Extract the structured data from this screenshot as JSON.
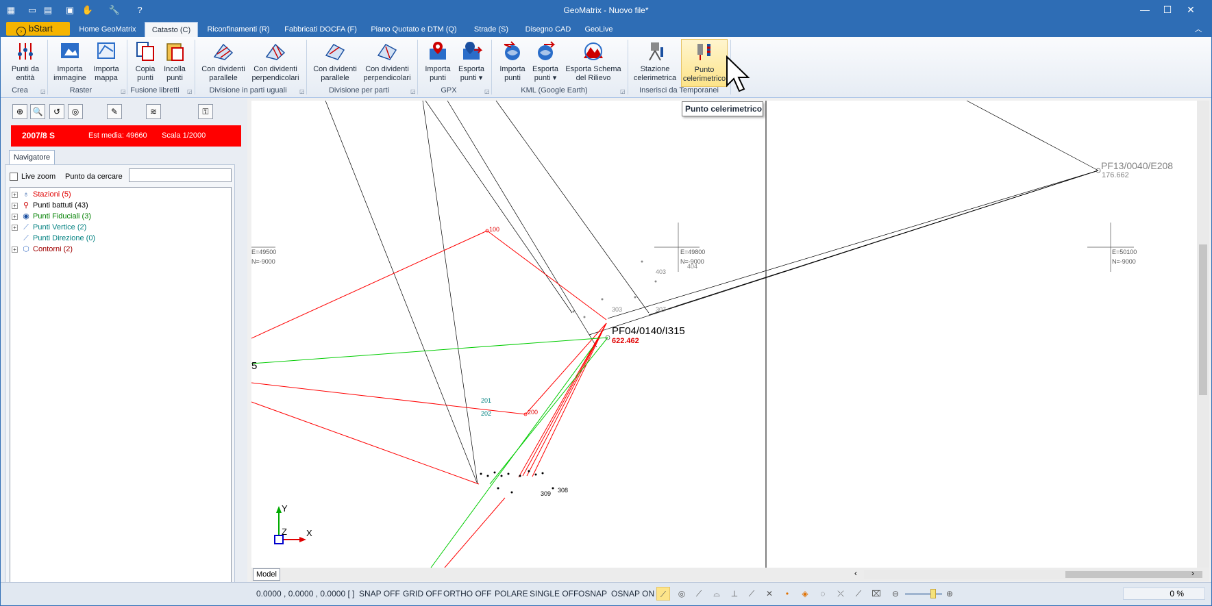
{
  "window": {
    "title": "GeoMatrix - Nuovo file*"
  },
  "quick_access": [
    "app-menu-icon",
    "new-file-icon",
    "open-file-icon",
    "save-icon",
    "hand-icon",
    "wrench-icon",
    "help-icon"
  ],
  "tabs": {
    "bstart": "bStart",
    "items": [
      {
        "label": "Home GeoMatrix"
      },
      {
        "label": "Catasto (C)"
      },
      {
        "label": "Riconfinamenti (R)"
      },
      {
        "label": "Fabbricati DOCFA (F)"
      },
      {
        "label": "Piano Quotato e DTM (Q)"
      },
      {
        "label": "Strade (S)"
      },
      {
        "label": "Disegno CAD"
      },
      {
        "label": "GeoLive"
      }
    ]
  },
  "ribbon": {
    "buttons": {
      "punti_entita": "Punti da\nentità",
      "importa_immagine": "Importa\nimmagine",
      "importa_mappa": "Importa\nmappa",
      "copia_punti": "Copia\npunti",
      "incolla_punti": "Incolla\npunti",
      "div_parallele": "Con dividenti\nparallele",
      "div_perp": "Con dividenti\nperpendicolari",
      "dp_parallele": "Con dividenti\nparallele",
      "dp_perp": "Con dividenti\nperpendicolari",
      "gpx_importa": "Importa\npunti",
      "gpx_esporta": "Esporta\npunti ▾",
      "kml_importa": "Importa\npunti",
      "kml_esporta": "Esporta\npunti ▾",
      "kml_schema": "Esporta Schema\ndel Rilievo",
      "stazione": "Stazione\ncelerimetrica",
      "punto_cel": "Punto\ncelerimetrico"
    },
    "groups": {
      "crea": "Crea",
      "raster": "Raster",
      "fusione": "Fusione libretti",
      "divisione_uguali": "Divisione in parti uguali",
      "divisione_parti": "Divisione per parti",
      "gpx": "GPX",
      "kml": "KML (Google Earth)",
      "temporanei": "Inserisci da Temporanei"
    }
  },
  "tooltip": "Punto celerimetrico",
  "info_bar": {
    "sheet": "2007/8 S",
    "est_media": "Est media: 49660",
    "scala": "Scala 1/2000",
    "color": "#ff0000"
  },
  "navigator": {
    "tab": "Navigatore",
    "live_zoom": "Live zoom",
    "search_label": "Punto da cercare",
    "search_value": "",
    "tree": [
      {
        "label": "Stazioni (5)",
        "color": "#e00000",
        "icon": "station-icon"
      },
      {
        "label": "Punti battuti (43)",
        "color": "#000000",
        "icon": "survey-point-icon"
      },
      {
        "label": "Punti Fiduciali (3)",
        "color": "#008000",
        "icon": "fiducial-icon"
      },
      {
        "label": "Punti Vertice (2)",
        "color": "#008080",
        "icon": "vertex-icon"
      },
      {
        "label": "Punti Direzione (0)",
        "color": "#008080",
        "icon": "direction-icon"
      },
      {
        "label": "Contorni (2)",
        "color": "#a00000",
        "icon": "contour-icon"
      }
    ]
  },
  "drawing": {
    "labels": {
      "pf13": "PF13/0040/E208",
      "pf13_q": "176.662",
      "pf04": "PF04/0140/I315",
      "pf04_q": "622.462",
      "e49500": "E=49500",
      "n9000a": "N=-9000",
      "e49800": "E=49800",
      "n9000b": "N=-9000",
      "e50100": "E=50100",
      "n9000c": "N=-9000",
      "p100": "100",
      "p200": "200",
      "p201": "201",
      "p202": "202",
      "p308": "308",
      "p309": "309",
      "p403": "403",
      "p404": "404",
      "p307": "307",
      "p303": "303",
      "p5": "5",
      "axis_y": "Y",
      "axis_x": "X",
      "axis_z": "Z"
    },
    "colors": {
      "red": "#ff0000",
      "green": "#00cc00",
      "black": "#000000",
      "gray": "#808080"
    }
  },
  "model_tab": "Model",
  "status": {
    "coords": "0.0000 , 0.0000 , 0.0000 [  ]",
    "snap": "SNAP OFF",
    "grid": "GRID OFF",
    "ortho": "ORTHO OFF",
    "polare": "POLARE",
    "single": "SINGLE OFF",
    "osnap": "OSNAP",
    "osnap_on": "OSNAP ON",
    "zoom": "0 %"
  }
}
